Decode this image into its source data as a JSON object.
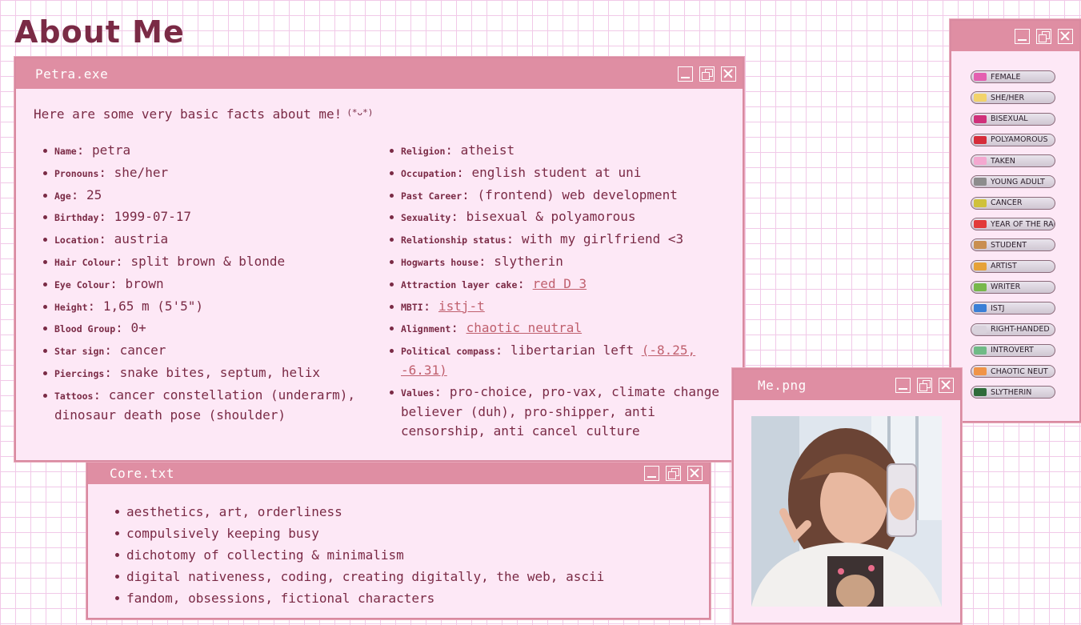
{
  "page": {
    "title": "About Me"
  },
  "petra_window": {
    "title": "Petra.exe",
    "intro": "Here are some very basic facts about me!",
    "kaomoji": "(*ᴗ*)",
    "left_facts": [
      {
        "key": "Name",
        "value": "petra"
      },
      {
        "key": "Pronouns",
        "value": "she/her"
      },
      {
        "key": "Age",
        "value": "25"
      },
      {
        "key": "Birthday",
        "value": "1999-07-17"
      },
      {
        "key": "Location",
        "value": "austria"
      },
      {
        "key": "Hair Colour",
        "value": "split brown & blonde"
      },
      {
        "key": "Eye Colour",
        "value": "brown"
      },
      {
        "key": "Height",
        "value": "1,65 m (5'5\")"
      },
      {
        "key": "Blood Group",
        "value": "0+"
      },
      {
        "key": "Star sign",
        "value": "cancer"
      },
      {
        "key": "Piercings",
        "value": "snake bites, septum, helix"
      },
      {
        "key": "Tattoos",
        "value": "cancer constellation (underarm), dinosaur death pose (shoulder)"
      }
    ],
    "right_facts": [
      {
        "key": "Religion",
        "value": "atheist"
      },
      {
        "key": "Occupation",
        "value": "english student at uni"
      },
      {
        "key": "Past Career",
        "value": "(frontend) web development"
      },
      {
        "key": "Sexuality",
        "value": "bisexual & polyamorous"
      },
      {
        "key": "Relationship status",
        "value": "with my girlfriend <3"
      },
      {
        "key": "Hogwarts house",
        "value": "slytherin"
      },
      {
        "key": "Attraction layer cake",
        "value": "",
        "link": "red D 3"
      },
      {
        "key": "MBTI",
        "value": "",
        "link": "istj-t"
      },
      {
        "key": "Alignment",
        "value": "",
        "link": "chaotic neutral"
      },
      {
        "key": "Political compass",
        "value": "libertarian left",
        "link": "(-8.25, -6.31)"
      },
      {
        "key": "Values",
        "value": "pro-choice, pro-vax, climate change believer (duh), pro-shipper, anti censorship, anti cancel culture"
      }
    ]
  },
  "core_window": {
    "title": "Core.txt",
    "items": [
      "aesthetics, art, orderliness",
      "compulsively keeping busy",
      "dichotomy of collecting & minimalism",
      "digital nativeness, coding, creating digitally, the web, ascii",
      "fandom, obsessions, fictional characters"
    ]
  },
  "photo_window": {
    "title": "Me.png"
  },
  "badges_window": {
    "badges": [
      {
        "label": "FEMALE",
        "color": "#e45fb0"
      },
      {
        "label": "SHE/HER",
        "color": "#f2d36b"
      },
      {
        "label": "BISEXUAL",
        "color": "#d0307a"
      },
      {
        "label": "POLYAMOROUS",
        "color": "#d62c3a"
      },
      {
        "label": "TAKEN",
        "color": "#f4a8d0"
      },
      {
        "label": "YOUNG ADULT",
        "color": "#8c8c8c"
      },
      {
        "label": "CANCER",
        "color": "#cfc13b"
      },
      {
        "label": "YEAR OF THE RABBIT",
        "color": "#e23a3a"
      },
      {
        "label": "STUDENT",
        "color": "#c98f4f"
      },
      {
        "label": "ARTIST",
        "color": "#e6a238"
      },
      {
        "label": "WRITER",
        "color": "#77b84b"
      },
      {
        "label": "ISTJ",
        "color": "#3a7fd6"
      },
      {
        "label": "RIGHT-HANDED",
        "color": "#d9d2dc"
      },
      {
        "label": "INTROVERT",
        "color": "#6fba86"
      },
      {
        "label": "CHAOTIC NEUT",
        "color": "#f09448"
      },
      {
        "label": "SLYTHERIN",
        "color": "#2e6b3a"
      }
    ]
  }
}
